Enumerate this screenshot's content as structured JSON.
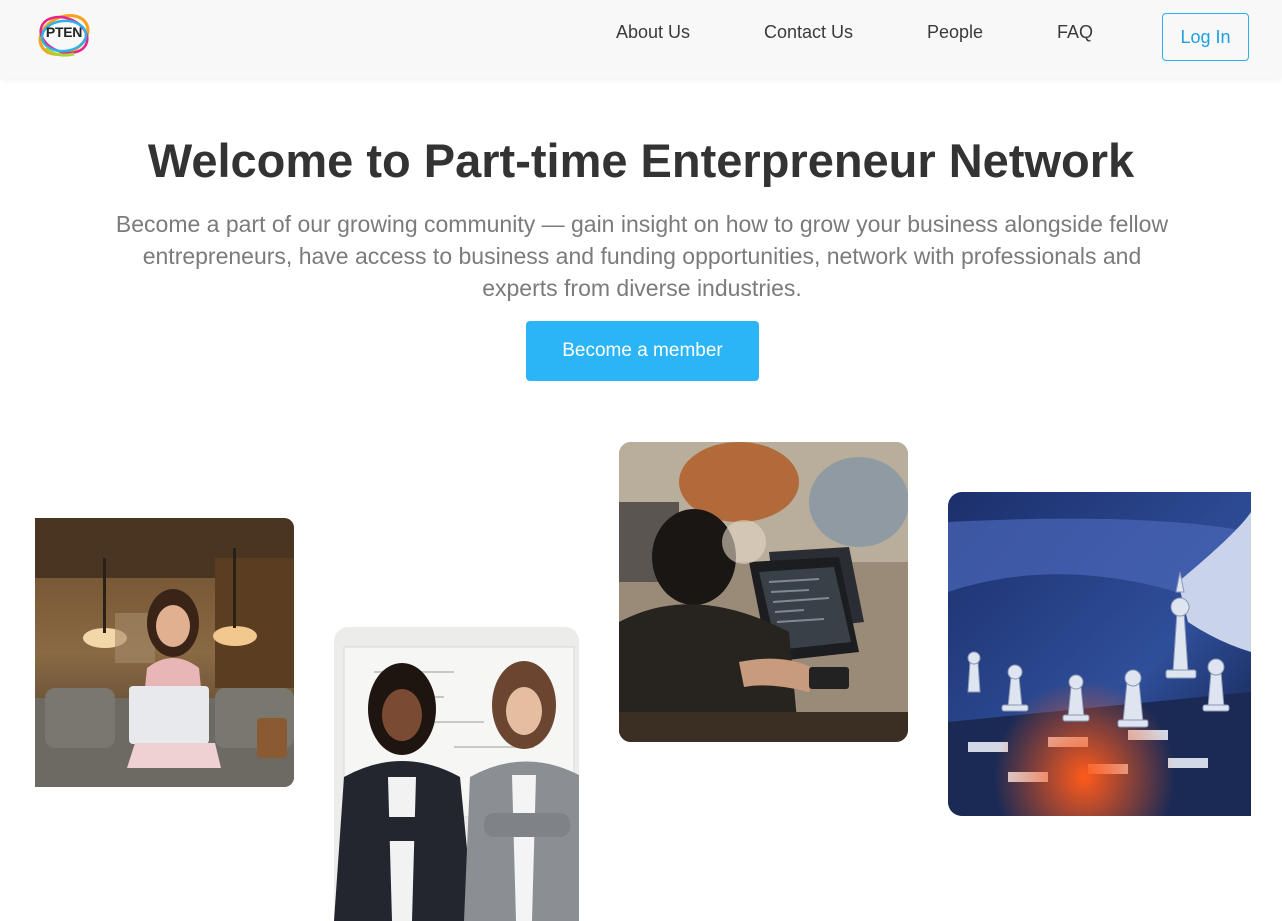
{
  "brand": {
    "logo_text": "PTEN"
  },
  "nav": {
    "items": [
      {
        "label": "About Us"
      },
      {
        "label": "Contact Us"
      },
      {
        "label": "People"
      },
      {
        "label": "FAQ"
      }
    ],
    "login_label": "Log In"
  },
  "hero": {
    "title": "Welcome to Part-time Enterpreneur Network",
    "subtitle": "Become a part of our growing community — gain insight on how to grow your business alongside fellow entrepreneurs, have access to business and funding opportunities, network with professionals and experts from diverse industries.",
    "cta_label": "Become a member"
  },
  "colors": {
    "accent": "#2bb5f7",
    "title": "#333333",
    "subtitle": "#7b7b7b",
    "nav_bg": "#f8f8f8"
  }
}
